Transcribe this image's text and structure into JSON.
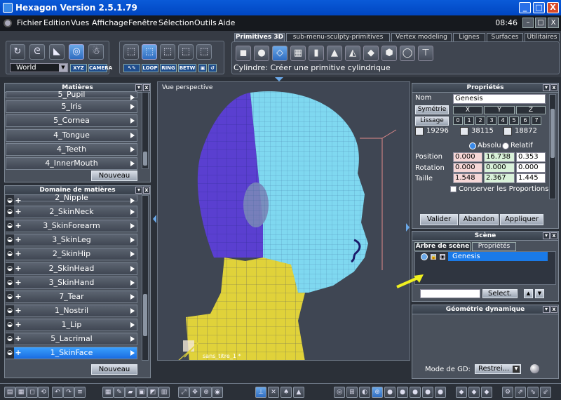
{
  "window": {
    "title": "Hexagon Version 2.5.1.79",
    "btn_min": "_",
    "btn_max": "□",
    "btn_close": "X"
  },
  "menu": {
    "items": [
      "Fichier",
      "Edition",
      "Vues",
      "Affichage",
      "Fenêtre",
      "Sélection",
      "Outils",
      "Aide"
    ],
    "clock": "08:46",
    "ctl_min": "–",
    "ctl_max": "□",
    "ctl_close": "X"
  },
  "toolbar": {
    "space_select": "World",
    "xyz_label": "XYZ",
    "camera_label": "CAMERA",
    "sel_labels": [
      "LOOP",
      "RING",
      "BETW"
    ],
    "tabs": [
      "Primitives 3D",
      "sub-menu-sculpty-primitives",
      "Vertex modeling",
      "Lignes",
      "Surfaces",
      "Utilitaires"
    ],
    "status": "Cylindre: Créer une primitive cylindrique"
  },
  "matieres": {
    "title": "Matières",
    "items": [
      "5_Pupil",
      "5_Iris",
      "5_Cornea",
      "4_Tongue",
      "4_Teeth",
      "4_InnerMouth"
    ],
    "new_label": "Nouveau"
  },
  "domaine": {
    "title": "Domaine de matières",
    "items": [
      "2_Nipple",
      "2_SkinNeck",
      "3_SkinForearm",
      "3_SkinLeg",
      "2_SkinHip",
      "2_SkinHead",
      "3_SkinHand",
      "7_Tear",
      "1_Nostril",
      "1_Lip",
      "5_Lacrimal",
      "1_SkinFace"
    ],
    "selected_index": 11,
    "new_label": "Nouveau"
  },
  "viewport": {
    "label": "Vue perspective",
    "doc_name": "sans_titre_1 *"
  },
  "proprietes": {
    "title": "Propriétés",
    "nom_label": "Nom",
    "nom_value": "Genesis",
    "symetrie_label": "Symétrie",
    "axes": [
      "X",
      "Y",
      "Z"
    ],
    "lissage_label": "Lissage",
    "lissage_levels": [
      "0",
      "1",
      "2",
      "3",
      "4",
      "5",
      "6",
      "7"
    ],
    "counts": [
      "19296",
      "38115",
      "18872"
    ],
    "absolu_label": "Absolu",
    "relatif_label": "Relatif",
    "position_label": "Position",
    "position": [
      "0.000",
      "16.738",
      "0.353"
    ],
    "rotation_label": "Rotation",
    "rotation": [
      "0.000",
      "0.000",
      "0.000"
    ],
    "taille_label": "Taille",
    "taille": [
      "1.548",
      "2.367",
      "1.445"
    ],
    "conserver_label": "Conserver les Proportions",
    "valider": "Valider",
    "abandon": "Abandon",
    "appliquer": "Appliquer"
  },
  "scene": {
    "title": "Scène",
    "tab1": "Arbre de scène",
    "tab2": "Propriétés",
    "node": "Genesis",
    "select_label": "Select."
  },
  "geometrie": {
    "title": "Géométrie dynamique",
    "mode_label": "Mode de GD:",
    "mode_value": "Restrei..."
  },
  "colors": {
    "accent": "#1a6ce0",
    "purple": "#5a3fd0",
    "cyan": "#7fd8f0",
    "yellow": "#e0d23a",
    "arrow": "#f0f020"
  },
  "icons": [
    "rotate-icon",
    "lasso-icon",
    "brush-icon",
    "magnet-icon",
    "ghost-icon",
    "cube-select-icon",
    "cube-vertex-icon",
    "cube-edge-icon",
    "cube-face-icon",
    "cube-object-icon",
    "cube-primitive-icon",
    "sphere-primitive-icon",
    "plane-primitive-icon",
    "cylinder-primitive-icon",
    "cone-primitive-icon",
    "pyramid-primitive-icon",
    "diamond-primitive-icon",
    "torus-primitive-icon"
  ]
}
